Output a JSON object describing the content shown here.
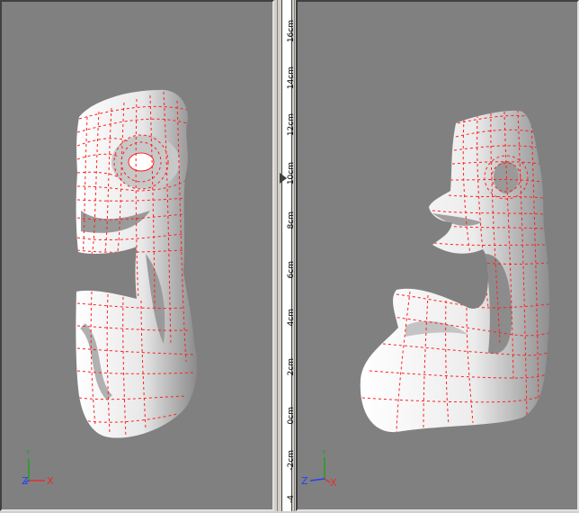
{
  "colors": {
    "viewport_bg": "#808080",
    "mesh": "#ff2020",
    "axis_x": "#e03030",
    "axis_y": "#20a020",
    "axis_z": "#2040ff"
  },
  "left_view": {
    "axes": {
      "x": "X",
      "y": "Y",
      "z": "Z"
    },
    "model": "face-carving-mesh-front"
  },
  "right_view": {
    "axes": {
      "x": "X",
      "y": "Y",
      "z": "Z"
    },
    "model": "face-carving-mesh-side"
  },
  "ruler": {
    "labels": [
      "16cm",
      "14cm",
      "12cm",
      "10cm",
      "8cm",
      "6cm",
      "4cm",
      "2cm",
      "0cm",
      "-2cm",
      "-4"
    ]
  }
}
